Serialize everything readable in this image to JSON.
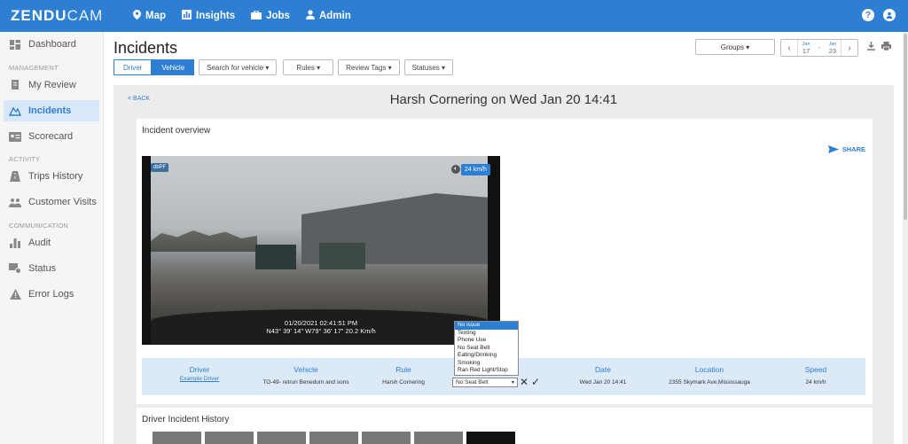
{
  "app": {
    "logo_main": "ZENDU",
    "logo_sub": "CAM"
  },
  "nav": [
    {
      "label": "Map",
      "icon": "map-pin-icon"
    },
    {
      "label": "Insights",
      "icon": "chart-icon"
    },
    {
      "label": "Jobs",
      "icon": "briefcase-icon"
    },
    {
      "label": "Admin",
      "icon": "user-icon"
    }
  ],
  "sidebar": {
    "dashboard": "Dashboard",
    "section_management": "MANAGEMENT",
    "my_review": "My Review",
    "incidents": "Incidents",
    "scorecard": "Scorecard",
    "section_activity": "ACTIVITY",
    "trips_history": "Trips History",
    "customer_visits": "Customer Visits",
    "section_communication": "COMMUNICATION",
    "audit": "Audit",
    "status": "Status",
    "error_logs": "Error Logs"
  },
  "page": {
    "title": "Incidents"
  },
  "filters": {
    "driver": "Driver",
    "vehicle": "Vehicle",
    "search_vehicle": "Search for vehicle",
    "rules": "Rules",
    "review_tags": "Review Tags",
    "statuses": "Statuses",
    "groups": "Groups"
  },
  "datepicker": {
    "start_month": "Jan",
    "start_day": "17",
    "end_month": "Jan",
    "end_day": "23",
    "sep": "-"
  },
  "incident": {
    "back": "< BACK",
    "title": "Harsh Cornering on Wed Jan 20 14:41",
    "overview_title": "Incident overview",
    "share": "SHARE",
    "video_badge": "dbPF",
    "speed_badge": "24 km/h",
    "timestamp": "01/20/2021 02:41:51 PM",
    "gps": "N43° 39' 14\" W79° 36' 17\" 20.2 Km/h"
  },
  "details": {
    "driver_h": "Driver",
    "driver_v": "Example Driver",
    "vehicle_h": "Vehicle",
    "vehicle_v": "TO-49- retrun Benedum and sons",
    "rule_h": "Rule",
    "rule_v": "Harsh Cornering",
    "status_v": "No Seat Belt",
    "date_h": "Date",
    "date_v": "Wed Jan 20 14:41",
    "location_h": "Location",
    "location_v": "2355 Skymark Ave,Mississauga",
    "speed_h": "Speed",
    "speed_v": "24 km/h"
  },
  "status_options": [
    "No issue",
    "Texting",
    "Phone Use",
    "No Seat Belt",
    "Eating/Drinking",
    "Smoking",
    "Ran Red Light/Stop"
  ],
  "history": {
    "title": "Driver Incident History"
  },
  "colors": {
    "primary": "#2d7fd3",
    "sidebar_active": "#d9e8f8",
    "details_bg": "#dce9f6"
  }
}
